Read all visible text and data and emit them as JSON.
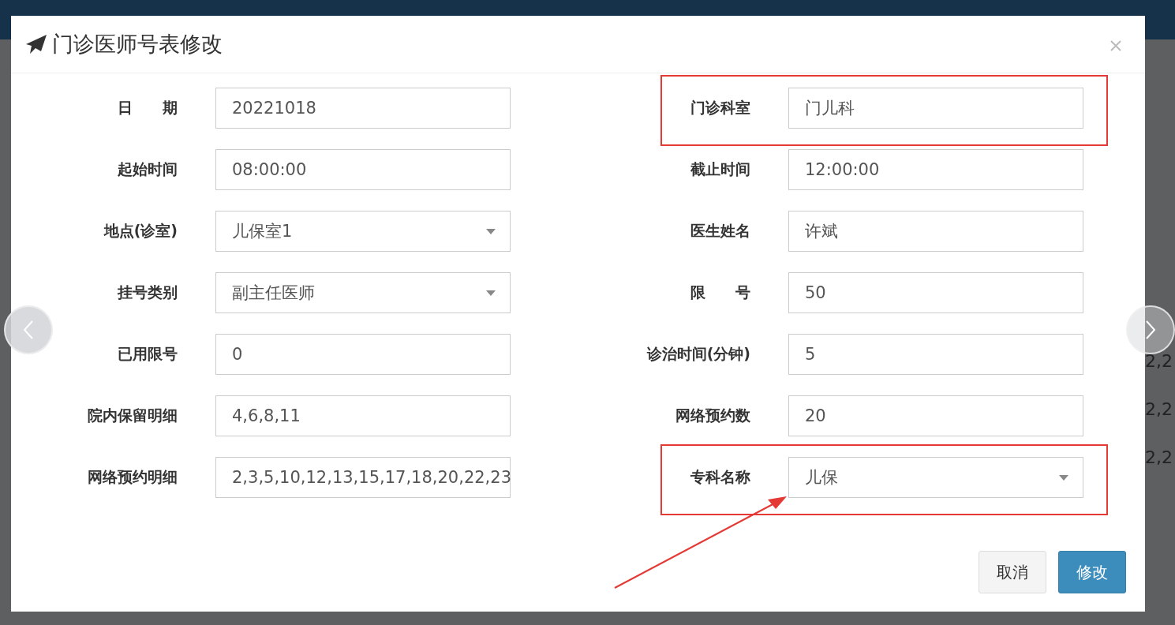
{
  "background": {
    "cells": [
      "2,2",
      "2,2",
      "2,2"
    ]
  },
  "dialog": {
    "title": "门诊医师号表修改",
    "fields": [
      {
        "label": "日　　期",
        "value": "20221018",
        "kind": "input",
        "highlighted": false
      },
      {
        "label": "门诊科室",
        "value": "门儿科",
        "kind": "input",
        "highlighted": true
      },
      {
        "label": "起始时间",
        "value": "08:00:00",
        "kind": "input",
        "highlighted": false
      },
      {
        "label": "截止时间",
        "value": "12:00:00",
        "kind": "input",
        "highlighted": false
      },
      {
        "label": "地点(诊室)",
        "value": "儿保室1",
        "kind": "select",
        "highlighted": false
      },
      {
        "label": "医生姓名",
        "value": "许斌",
        "kind": "input",
        "highlighted": false
      },
      {
        "label": "挂号类别",
        "value": "副主任医师",
        "kind": "select",
        "highlighted": false
      },
      {
        "label": "限　　号",
        "value": "50",
        "kind": "input",
        "highlighted": false
      },
      {
        "label": "已用限号",
        "value": "0",
        "kind": "input",
        "highlighted": false
      },
      {
        "label": "诊治时间(分钟)",
        "value": "5",
        "kind": "input",
        "highlighted": false
      },
      {
        "label": "院内保留明细",
        "value": "4,6,8,11",
        "kind": "input",
        "highlighted": false
      },
      {
        "label": "网络预约数",
        "value": "20",
        "kind": "input",
        "highlighted": false
      },
      {
        "label": "网络预约明细",
        "value": "2,3,5,10,12,13,15,17,18,20,22,23",
        "kind": "input",
        "highlighted": false
      },
      {
        "label": "专科名称",
        "value": "儿保",
        "kind": "select",
        "highlighted": true
      }
    ],
    "buttons": [
      {
        "label": "取消",
        "kind": "default"
      },
      {
        "label": "修改",
        "kind": "primary"
      }
    ]
  }
}
